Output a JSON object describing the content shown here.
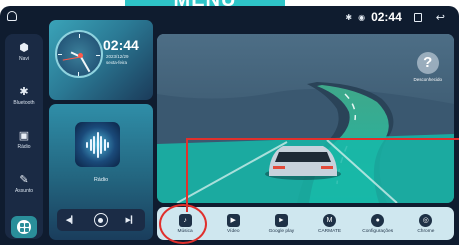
{
  "banner": {
    "title": "MENU PRINCIPAL"
  },
  "statusbar": {
    "time": "02:44",
    "bluetooth_icon": "bluetooth-icon",
    "location_icon": "location-icon"
  },
  "sidebar": {
    "items": [
      {
        "label": "Navi",
        "icon": "navigation-icon"
      },
      {
        "label": "Bluetooth",
        "icon": "bluetooth-icon"
      },
      {
        "label": "Rádio",
        "icon": "radio-icon"
      },
      {
        "label": "Assunto",
        "icon": "brush-icon"
      }
    ]
  },
  "clock_widget": {
    "time": "02:44",
    "date": "2023/12/29",
    "weekday": "sexta-feira"
  },
  "radio_widget": {
    "label": "Rádio"
  },
  "scene": {
    "unknown_label": "Desconhecido"
  },
  "dock": {
    "items": [
      {
        "label": "Música",
        "icon": "music-icon"
      },
      {
        "label": "Vídeo",
        "icon": "video-icon"
      },
      {
        "label": "Google play",
        "icon": "google-play-icon"
      },
      {
        "label": "CARMATE",
        "icon": "carmate-icon"
      },
      {
        "label": "Configurações",
        "icon": "settings-icon"
      },
      {
        "label": "Chrome",
        "icon": "chrome-icon"
      }
    ]
  },
  "colors": {
    "accent": "#2ec4c8",
    "highlight": "#e0302c",
    "background": "#0f1c2f"
  }
}
